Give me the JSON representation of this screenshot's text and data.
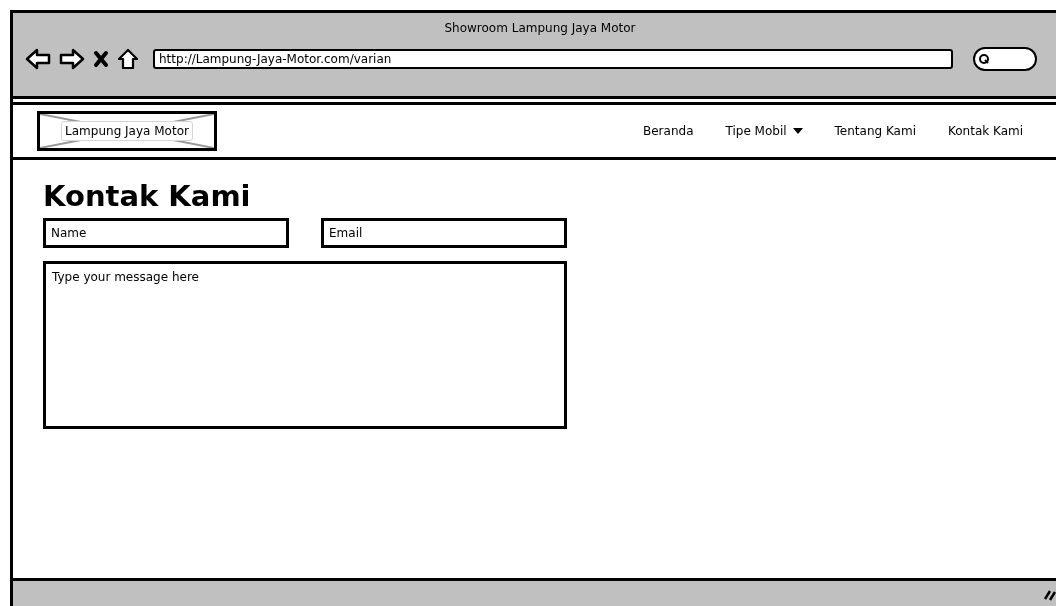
{
  "window": {
    "title": "Showroom Lampung Jaya Motor"
  },
  "browser": {
    "url": "http://Lampung-Jaya-Motor.com/varian"
  },
  "header": {
    "logo": "Lampung Jaya Motor",
    "nav": [
      {
        "label": "Beranda",
        "kind": "link"
      },
      {
        "label": "Tipe Mobil",
        "kind": "dropdown"
      },
      {
        "label": "Tentang Kami",
        "kind": "link"
      },
      {
        "label": "Kontak Kami",
        "kind": "link"
      }
    ]
  },
  "page": {
    "heading": "Kontak Kami",
    "name_field": {
      "placeholder": "Name"
    },
    "email_field": {
      "placeholder": "Email"
    },
    "message_field": {
      "placeholder": "Type your message here"
    }
  }
}
